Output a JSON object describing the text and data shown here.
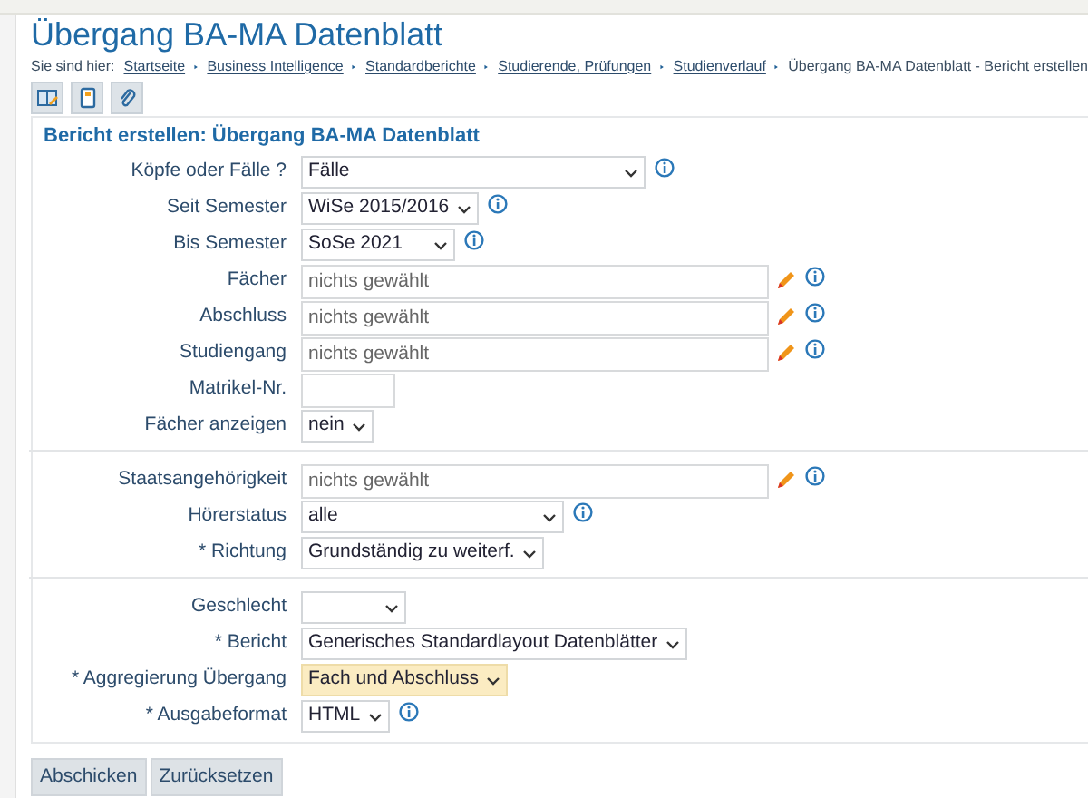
{
  "page": {
    "title": "Übergang BA-MA Datenblatt"
  },
  "breadcrumb": {
    "prefix": "Sie sind hier:",
    "items": [
      {
        "label": "Startseite",
        "link": true
      },
      {
        "label": "Business Intelligence",
        "link": true
      },
      {
        "label": "Standardberichte",
        "link": true
      },
      {
        "label": "Studierende, Prüfungen",
        "link": true
      },
      {
        "label": "Studienverlauf",
        "link": true
      },
      {
        "label": "Übergang BA-MA Datenblatt - Bericht erstellen",
        "link": false
      }
    ]
  },
  "toolbar": [
    {
      "kind": "book"
    },
    {
      "kind": "page"
    },
    {
      "kind": "clip"
    }
  ],
  "form": {
    "heading": "Bericht erstellen: Übergang BA-MA Datenblatt",
    "sections": [
      {
        "fields": [
          {
            "label": "Köpfe oder Fälle ?",
            "kind": "select",
            "value": "Fälle",
            "info": true,
            "highlighted": false
          },
          {
            "label": "Seit Semester",
            "kind": "select",
            "value": "WiSe 2015/2016",
            "info": true,
            "highlighted": false
          },
          {
            "label": "Bis Semester",
            "kind": "select",
            "value": "SoSe 2021",
            "info": true,
            "highlighted": false
          },
          {
            "label": "Fächer",
            "kind": "picker",
            "placeholder": "nichts gewählt",
            "info": true
          },
          {
            "label": "Abschluss",
            "kind": "picker",
            "placeholder": "nichts gewählt",
            "info": true
          },
          {
            "label": "Studiengang",
            "kind": "picker",
            "placeholder": "nichts gewählt",
            "info": true
          },
          {
            "label": "Matrikel-Nr.",
            "kind": "input",
            "info": false
          },
          {
            "label": "Fächer anzeigen",
            "kind": "select",
            "value": "nein",
            "info": false,
            "highlighted": false
          }
        ]
      },
      {
        "fields": [
          {
            "label": "Staatsangehörigkeit",
            "kind": "picker",
            "placeholder": "nichts gewählt",
            "info": true
          },
          {
            "label": "Hörerstatus",
            "kind": "select",
            "value": "alle",
            "info": true,
            "highlighted": false
          },
          {
            "label": "* Richtung",
            "kind": "select",
            "value": "Grundständig zu weiterf.",
            "info": false,
            "highlighted": false
          }
        ]
      },
      {
        "fields": [
          {
            "label": "Geschlecht",
            "kind": "select",
            "info": false,
            "highlighted": false
          },
          {
            "label": "* Bericht",
            "kind": "select",
            "value": "Generisches Standardlayout Datenblätter",
            "info": false,
            "highlighted": false
          },
          {
            "label": "* Aggregierung Übergang",
            "kind": "select",
            "value": "Fach und Abschluss",
            "info": false,
            "highlighted": true
          },
          {
            "label": "* Ausgabeformat",
            "kind": "select",
            "value": "HTML",
            "info": true,
            "highlighted": false
          }
        ]
      }
    ]
  },
  "buttons": [
    "Abschicken",
    "Zurücksetzen"
  ]
}
